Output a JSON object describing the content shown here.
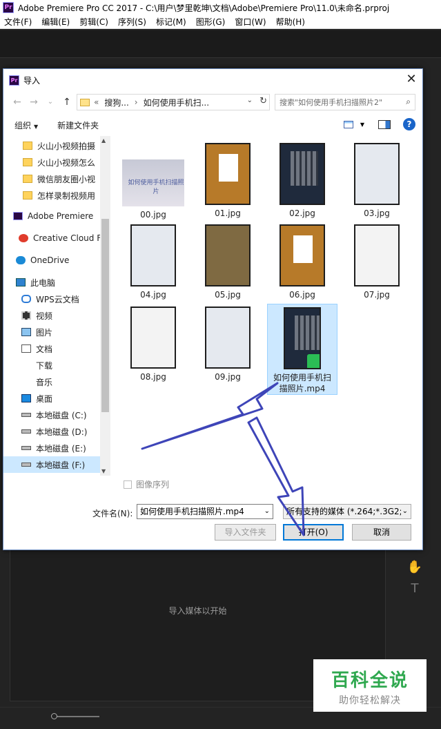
{
  "app": {
    "logo": "Pr",
    "title": "Adobe Premiere Pro CC 2017 - C:\\用户\\梦里乾坤\\文档\\Adobe\\Premiere Pro\\11.0\\未命名.prproj",
    "menu": [
      "文件(F)",
      "编辑(E)",
      "剪辑(C)",
      "序列(S)",
      "标记(M)",
      "图形(G)",
      "窗口(W)",
      "帮助(H)"
    ],
    "panel_hint": "导入媒体以开始"
  },
  "dialog": {
    "logo": "Pr",
    "title": "导入",
    "address": {
      "prefix": "«",
      "segments": [
        "搜狗...",
        "如何使用手机扫..."
      ],
      "separator": "›"
    },
    "search_placeholder": "搜索\"如何使用手机扫描照片2\"",
    "toolbar": {
      "organize": "组织",
      "new_folder": "新建文件夹"
    },
    "sidebar": [
      {
        "label": "火山小视频拍摄",
        "icon": "folder-icon"
      },
      {
        "label": "火山小视频怎么",
        "icon": "folder-icon"
      },
      {
        "label": "微信朋友圈小视",
        "icon": "folder-icon"
      },
      {
        "label": "怎样录制视频用",
        "icon": "folder-icon"
      },
      {
        "label": "Adobe Premiere",
        "icon": "premiere-icon"
      },
      {
        "label": "Creative Cloud F",
        "icon": "creative-cloud-icon"
      },
      {
        "label": "OneDrive",
        "icon": "onedrive-icon"
      },
      {
        "label": "此电脑",
        "icon": "computer-icon"
      },
      {
        "label": "WPS云文档",
        "icon": "wps-cloud-icon"
      },
      {
        "label": "视频",
        "icon": "video-folder-icon"
      },
      {
        "label": "图片",
        "icon": "pictures-folder-icon"
      },
      {
        "label": "文档",
        "icon": "documents-folder-icon"
      },
      {
        "label": "下载",
        "icon": "download-icon"
      },
      {
        "label": "音乐",
        "icon": "music-icon"
      },
      {
        "label": "桌面",
        "icon": "desktop-icon"
      },
      {
        "label": "本地磁盘 (C:)",
        "icon": "drive-icon"
      },
      {
        "label": "本地磁盘 (D:)",
        "icon": "drive-icon"
      },
      {
        "label": "本地磁盘 (E:)",
        "icon": "drive-icon"
      },
      {
        "label": "本地磁盘 (F:)",
        "icon": "drive-icon",
        "selected": true
      }
    ],
    "files": [
      {
        "name": "00.jpg",
        "kind": "landscape",
        "thumb_text": "如何使用手机扫描照片"
      },
      {
        "name": "01.jpg",
        "kind": "paper"
      },
      {
        "name": "02.jpg",
        "kind": "phone"
      },
      {
        "name": "03.jpg",
        "kind": "light"
      },
      {
        "name": "04.jpg",
        "kind": "light"
      },
      {
        "name": "05.jpg",
        "kind": "grid"
      },
      {
        "name": "06.jpg",
        "kind": "paper"
      },
      {
        "name": "07.jpg",
        "kind": "note"
      },
      {
        "name": "08.jpg",
        "kind": "note"
      },
      {
        "name": "09.jpg",
        "kind": "light"
      },
      {
        "name": "如何使用手机扫描照片.mp4",
        "kind": "phone",
        "selected": true
      }
    ],
    "image_sequence_label": "图像序列",
    "filename_label": "文件名(N):",
    "filename_value": "如何使用手机扫描照片.mp4",
    "filetype_value": "所有支持的媒体 (*.264;*.3G2;*",
    "buttons": {
      "import_folder": "导入文件夹",
      "open": "打开(O)",
      "cancel": "取消"
    }
  },
  "watermark": {
    "title": "百科全说",
    "subtitle": "助你轻松解决"
  },
  "colors": {
    "accent": "#0078d7",
    "selection": "#cce8ff",
    "arrow": "#3e45b8",
    "watermark_green": "#2fa84f"
  }
}
